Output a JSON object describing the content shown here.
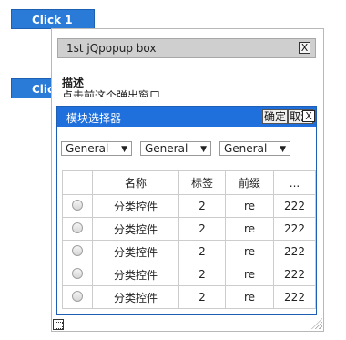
{
  "buttons": {
    "click1": "Click 1",
    "click2": "Clic"
  },
  "popup1": {
    "title": "1st jQpopup box",
    "close": "X",
    "heading": "描述",
    "cut_text": "点击前这个弹出窗口"
  },
  "popup2": {
    "title": "模块选择器",
    "ok": "确定",
    "cancel": "取消",
    "close": "X",
    "selects": [
      "General",
      "General",
      "General"
    ],
    "columns": [
      "",
      "名称",
      "标签",
      "前缀",
      "..."
    ],
    "rows": [
      {
        "name": "分类控件",
        "tag": "2",
        "prefix": "re",
        "count": "222"
      },
      {
        "name": "分类控件",
        "tag": "2",
        "prefix": "re",
        "count": "222"
      },
      {
        "name": "分类控件",
        "tag": "2",
        "prefix": "re",
        "count": "222"
      },
      {
        "name": "分类控件",
        "tag": "2",
        "prefix": "re",
        "count": "222"
      },
      {
        "name": "分类控件",
        "tag": "2",
        "prefix": "re",
        "count": "222"
      }
    ]
  },
  "colors": {
    "button_blue": "#2a7ad8",
    "header_blue": "#1f6fdc",
    "gray_header": "#cfcfcf"
  }
}
